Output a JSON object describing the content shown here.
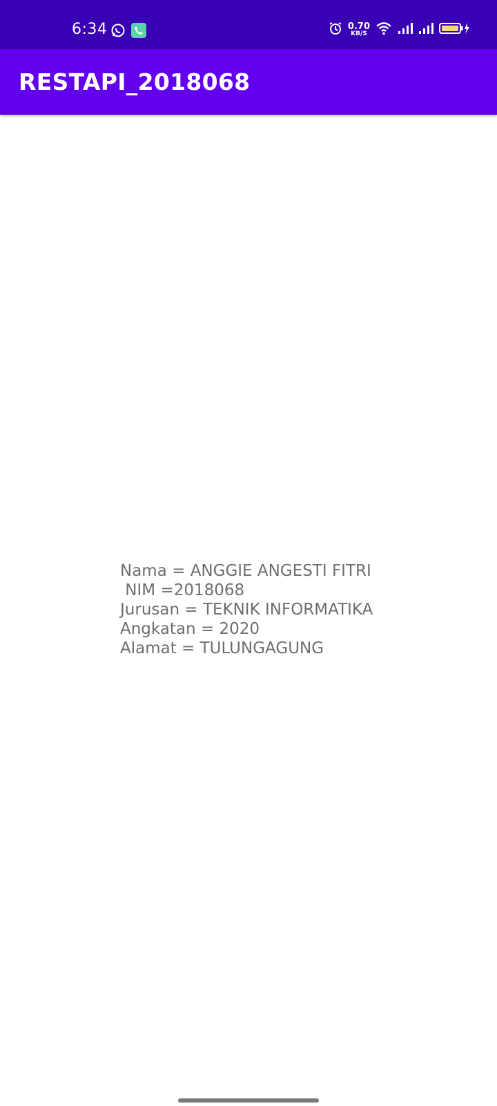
{
  "status_bar": {
    "time": "6:34",
    "left_icons": [
      "whatsapp-icon",
      "phone-call-icon"
    ],
    "network_speed": "0.70",
    "network_speed_unit": "KB/S",
    "right_icons": [
      "alarm-icon",
      "wifi-icon",
      "signal-icon",
      "signal-icon",
      "battery-charging-icon"
    ],
    "bg_color": "#3a00b4"
  },
  "app_bar": {
    "title": "RESTAPI_2018068",
    "bg_color": "#6200ee"
  },
  "content": {
    "lines": [
      "Nama = ANGGIE ANGESTI FITRI",
      " NIM =2018068",
      "Jurusan = TEKNIK INFORMATIKA",
      "Angkatan = 2020",
      "Alamat = TULUNGAGUNG"
    ],
    "text_color": "#6e6e6e"
  }
}
